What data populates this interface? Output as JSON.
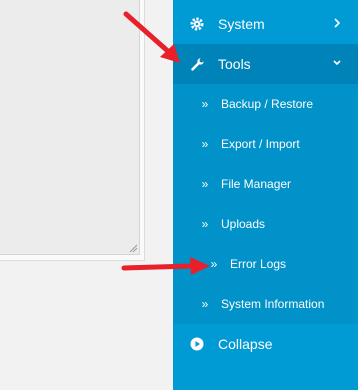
{
  "sidebar": {
    "items": [
      {
        "label": "System",
        "icon": "gear-icon"
      },
      {
        "label": "Tools",
        "icon": "wrench-icon"
      },
      {
        "label": "Collapse",
        "icon": "play-circle-icon"
      }
    ],
    "tools_submenu": [
      {
        "label": "Backup / Restore"
      },
      {
        "label": "Export / Import"
      },
      {
        "label": "File Manager"
      },
      {
        "label": "Uploads"
      },
      {
        "label": "Error Logs"
      },
      {
        "label": "System Information"
      }
    ],
    "colors": {
      "sidebar": "#009ad5",
      "active": "#0083b8",
      "submenu": "#0092c9",
      "arrow": "#e8202a"
    }
  }
}
